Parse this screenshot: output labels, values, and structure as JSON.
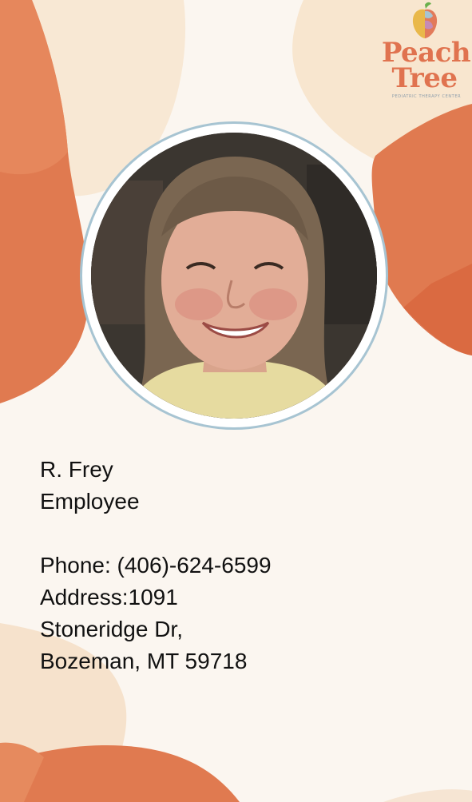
{
  "logo": {
    "word_1": "Peach",
    "word_2": "Tree",
    "tagline": "PEDIATRIC THERAPY CENTER"
  },
  "photo": {
    "icon": "employee-photo"
  },
  "employee": {
    "name": "R. Frey",
    "role": "Employee",
    "phone": "Phone: (406)-624-6599",
    "address_line_1": "Address:1091",
    "address_line_2": "Stoneridge Dr,",
    "address_line_3": "Bozeman, MT 59718"
  },
  "colors": {
    "background": "#fbf6f0",
    "peach_light": "#f8e8d4",
    "orange": "#e37f55",
    "orange_dark": "#d9683f",
    "frame_ring": "#a7c4d2",
    "logo_text": "#e0734f"
  }
}
